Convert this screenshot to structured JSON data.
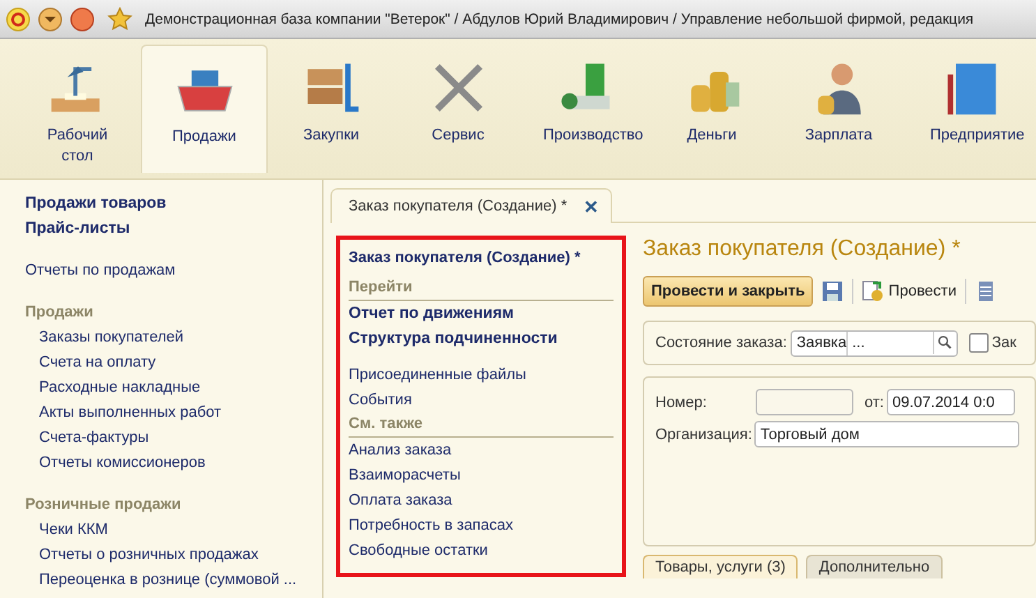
{
  "window": {
    "title": "Демонстрационная база компании \"Ветерок\" / Абдулов Юрий Владимирович / Управление небольшой фирмой, редакция"
  },
  "sections": [
    {
      "label": "Рабочий стол",
      "selected": false
    },
    {
      "label": "Продажи",
      "selected": true
    },
    {
      "label": "Закупки",
      "selected": false
    },
    {
      "label": "Сервис",
      "selected": false
    },
    {
      "label": "Производство",
      "selected": false
    },
    {
      "label": "Деньги",
      "selected": false
    },
    {
      "label": "Зарплата",
      "selected": false
    },
    {
      "label": "Предприятие",
      "selected": false
    }
  ],
  "sidebar": {
    "items": [
      {
        "kind": "main",
        "label": "Продажи товаров"
      },
      {
        "kind": "main",
        "label": "Прайс-листы"
      },
      {
        "kind": "link",
        "label": "Отчеты по продажам"
      },
      {
        "kind": "group",
        "label": "Продажи",
        "children": [
          {
            "label": "Заказы покупателей"
          },
          {
            "label": "Счета на оплату"
          },
          {
            "label": "Расходные накладные"
          },
          {
            "label": "Акты выполненных работ"
          },
          {
            "label": "Счета-фактуры"
          },
          {
            "label": "Отчеты комиссионеров"
          }
        ]
      },
      {
        "kind": "group",
        "label": "Розничные продажи",
        "children": [
          {
            "label": "Чеки ККМ"
          },
          {
            "label": "Отчеты о розничных продажах"
          },
          {
            "label": "Переоценка в рознице (суммовой ..."
          }
        ]
      }
    ]
  },
  "tab": {
    "label": "Заказ покупателя (Создание) *",
    "close": "✕"
  },
  "nav_panel": {
    "title": "Заказ покупателя (Создание) *",
    "items": [
      {
        "kind": "header",
        "label": "Перейти"
      },
      {
        "kind": "main",
        "label": "Отчет по движениям"
      },
      {
        "kind": "main",
        "label": "Структура подчиненности"
      },
      {
        "kind": "gap"
      },
      {
        "kind": "link",
        "label": "Присоединенные файлы"
      },
      {
        "kind": "link",
        "label": "События"
      },
      {
        "kind": "header",
        "label": "См. также"
      },
      {
        "kind": "link",
        "label": "Анализ заказа"
      },
      {
        "kind": "link",
        "label": "Взаиморасчеты"
      },
      {
        "kind": "link",
        "label": "Оплата заказа"
      },
      {
        "kind": "link",
        "label": "Потребность в запасах"
      },
      {
        "kind": "link",
        "label": "Свободные остатки"
      }
    ]
  },
  "form": {
    "title": "Заказ покупателя (Создание) *",
    "toolbar": {
      "primary": "Провести и закрыть",
      "post": "Провести"
    },
    "status": {
      "label": "Состояние заказа:",
      "value": "Заявка",
      "choose": "...",
      "checkbox_label": "Зак",
      "checked": false
    },
    "number": {
      "label": "Номер:"
    },
    "date": {
      "label": "от:",
      "value": "09.07.2014  0:0"
    },
    "organization": {
      "label": "Организация:",
      "value": "Торговый дом"
    },
    "tabs": [
      {
        "label": "Товары, услуги (3)",
        "selected": true
      },
      {
        "label": "Дополнительно",
        "selected": false
      }
    ]
  }
}
